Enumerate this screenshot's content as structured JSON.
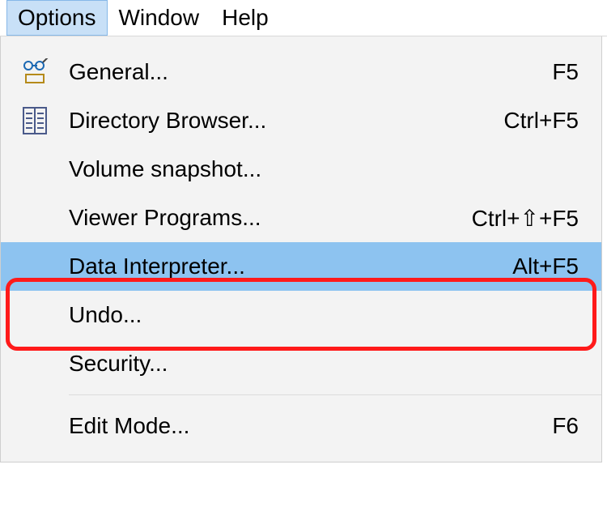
{
  "menubar": {
    "options": "Options",
    "window": "Window",
    "help": "Help"
  },
  "menu": {
    "general": {
      "label": "General...",
      "shortcut": "F5"
    },
    "directoryBrowser": {
      "label": "Directory Browser...",
      "shortcut": "Ctrl+F5"
    },
    "volumeSnapshot": {
      "label": "Volume snapshot...",
      "shortcut": ""
    },
    "viewerPrograms": {
      "label": "Viewer Programs...",
      "shortcut": "Ctrl+⇧+F5"
    },
    "dataInterpreter": {
      "label": "Data Interpreter...",
      "shortcut": "Alt+F5"
    },
    "undo": {
      "label": "Undo...",
      "shortcut": ""
    },
    "security": {
      "label": "Security...",
      "shortcut": ""
    },
    "editMode": {
      "label": "Edit Mode...",
      "shortcut": "F6"
    }
  }
}
